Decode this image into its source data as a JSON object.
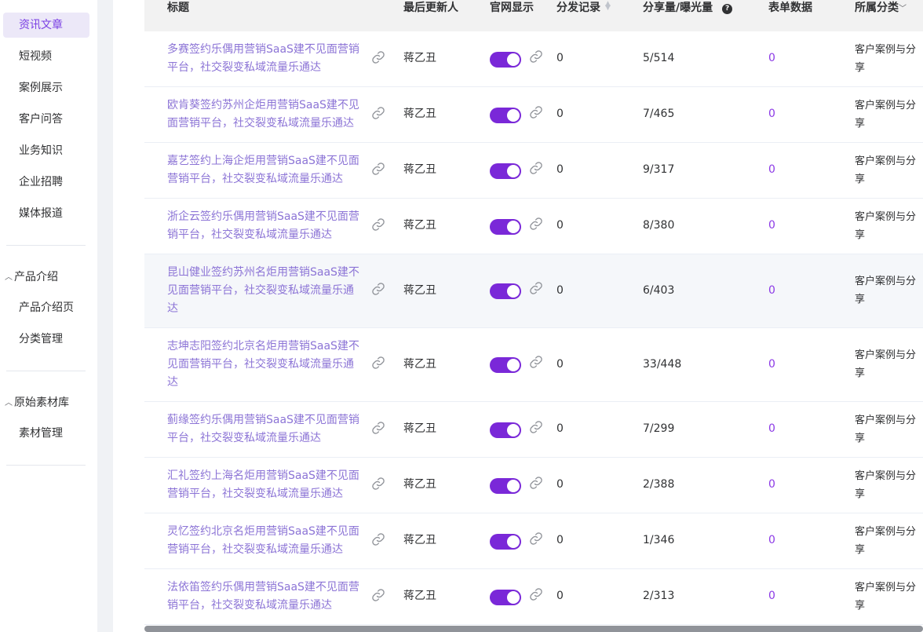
{
  "sidebar": {
    "items_top": [
      {
        "label": "资讯文章",
        "active": true
      },
      {
        "label": "短视频"
      },
      {
        "label": "案例展示"
      },
      {
        "label": "客户问答"
      },
      {
        "label": "业务知识"
      },
      {
        "label": "企业招聘"
      },
      {
        "label": "媒体报道"
      }
    ],
    "group_product": {
      "label": "产品介绍",
      "items": [
        "产品介绍页",
        "分类管理"
      ]
    },
    "group_material": {
      "label": "原始素材库",
      "items": [
        "素材管理"
      ]
    }
  },
  "table": {
    "headers": {
      "title": "标题",
      "updater": "最后更新人",
      "site_display": "官网显示",
      "dist_record": "分发记录",
      "share_exposure": "分享量/曝光量",
      "form_data": "表单数据",
      "category": "所属分类"
    },
    "rows": [
      {
        "title": "多赛签约乐偶用营销SaaS建不见面营销平台，社交裂变私域流量乐通达",
        "updater": "蒋乙丑",
        "site_display": true,
        "dist": "0",
        "share": "5/514",
        "form": "0",
        "category": "客户案例与分享"
      },
      {
        "title": "欧肯葵签约苏州企炬用营销SaaS建不见面营销平台，社交裂变私域流量乐通达",
        "updater": "蒋乙丑",
        "site_display": true,
        "dist": "0",
        "share": "7/465",
        "form": "0",
        "category": "客户案例与分享"
      },
      {
        "title": "嘉艺签约上海企炬用营销SaaS建不见面营销平台，社交裂变私域流量乐通达",
        "updater": "蒋乙丑",
        "site_display": true,
        "dist": "0",
        "share": "9/317",
        "form": "0",
        "category": "客户案例与分享"
      },
      {
        "title": "浙企云签约乐偶用营销SaaS建不见面营销平台，社交裂变私域流量乐通达",
        "updater": "蒋乙丑",
        "site_display": true,
        "dist": "0",
        "share": "8/380",
        "form": "0",
        "category": "客户案例与分享"
      },
      {
        "title": "昆山健业签约苏州名炬用营销SaaS建不见面营销平台，社交裂变私域流量乐通达",
        "updater": "蒋乙丑",
        "site_display": true,
        "dist": "0",
        "share": "6/403",
        "form": "0",
        "category": "客户案例与分享"
      },
      {
        "title": "志坤志阳签约北京名炬用营销SaaS建不见面营销平台，社交裂变私域流量乐通达",
        "updater": "蒋乙丑",
        "site_display": true,
        "dist": "0",
        "share": "33/448",
        "form": "0",
        "category": "客户案例与分享"
      },
      {
        "title": "蓟缘签约乐偶用营销SaaS建不见面营销平台，社交裂变私域流量乐通达",
        "updater": "蒋乙丑",
        "site_display": true,
        "dist": "0",
        "share": "7/299",
        "form": "0",
        "category": "客户案例与分享"
      },
      {
        "title": "汇礼签约上海名炬用营销SaaS建不见面营销平台，社交裂变私域流量乐通达",
        "updater": "蒋乙丑",
        "site_display": true,
        "dist": "0",
        "share": "2/388",
        "form": "0",
        "category": "客户案例与分享"
      },
      {
        "title": "灵忆签约北京名炬用营销SaaS建不见面营销平台，社交裂变私域流量乐通达",
        "updater": "蒋乙丑",
        "site_display": true,
        "dist": "0",
        "share": "1/346",
        "form": "0",
        "category": "客户案例与分享"
      },
      {
        "title": "法依笛签约乐偶用营销SaaS建不见面营销平台，社交裂变私域流量乐通达",
        "updater": "蒋乙丑",
        "site_display": true,
        "dist": "0",
        "share": "2/313",
        "form": "0",
        "category": "客户案例与分享"
      }
    ]
  },
  "colors": {
    "accent": "#7a28d8",
    "title_link": "#8c74d6",
    "active_nav_bg": "#ece8f8"
  }
}
